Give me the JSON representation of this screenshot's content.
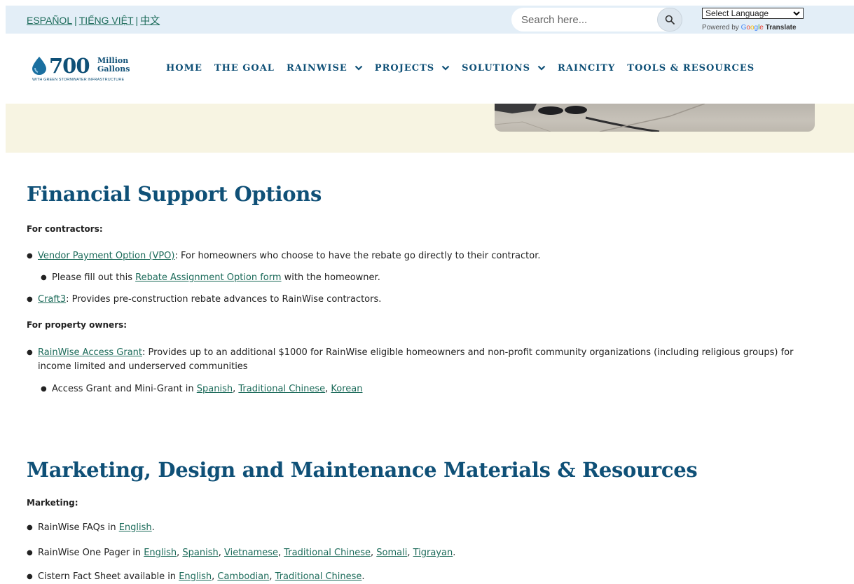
{
  "topbar": {
    "langs": [
      "ESPAÑOL",
      "TIẾNG VIỆT",
      "中文"
    ],
    "separator": "|",
    "search_placeholder": "Search here...",
    "select_language": "Select Language",
    "powered_prefix": "Powered by",
    "google": "Google",
    "translate": "Translate"
  },
  "logo": {
    "number": "700",
    "line1": "Million",
    "line2": "Gallons",
    "tagline": "WITH GREEN STORMWATER INFRASTRUCTURE"
  },
  "nav": {
    "home": "HOME",
    "goal": "THE GOAL",
    "rainwise": "RAINWISE",
    "projects": "PROJECTS",
    "solutions": "SOLUTIONS",
    "raincity": "RAINCITY",
    "tools": "TOOLS & RESOURCES"
  },
  "financial": {
    "heading": "Financial Support Options",
    "contractors_label": "For contractors:",
    "vpo_link": "Vendor Payment Option (VPO)",
    "vpo_text": ": For homeowners who choose to have the rebate go directly to their contractor.",
    "fill_prefix": "Please fill out this ",
    "rebate_link": "Rebate Assignment Option form",
    "fill_suffix": " with the homeowner.",
    "craft3_link": "Craft3",
    "craft3_text": ": Provides pre-construction rebate advances to RainWise contractors.",
    "owners_label": "For property owners:",
    "grant_link": "RainWise Access Grant",
    "grant_text": ": Provides up to an additional $1000 for RainWise eligible homeowners and non-profit community organizations (including religious groups) for income limited and underserved communities",
    "mini_prefix": "Access Grant and Mini-Grant in ",
    "mini_links": [
      "Spanish",
      "Traditional Chinese",
      "Korean"
    ]
  },
  "marketing": {
    "heading": "Marketing, Design and Maintenance Materials & Resources",
    "label": "Marketing:",
    "faq_prefix": "RainWise FAQs in ",
    "faq_link": "English",
    "pager_prefix": "RainWise One Pager in ",
    "pager_links": [
      "English",
      "Spanish",
      "Vietnamese",
      "Traditional Chinese",
      "Somali",
      "Tigrayan"
    ],
    "cistern_prefix": "Cistern Fact Sheet available in ",
    "cistern_links": [
      "English",
      "Cambodian",
      "Traditional Chinese"
    ]
  }
}
